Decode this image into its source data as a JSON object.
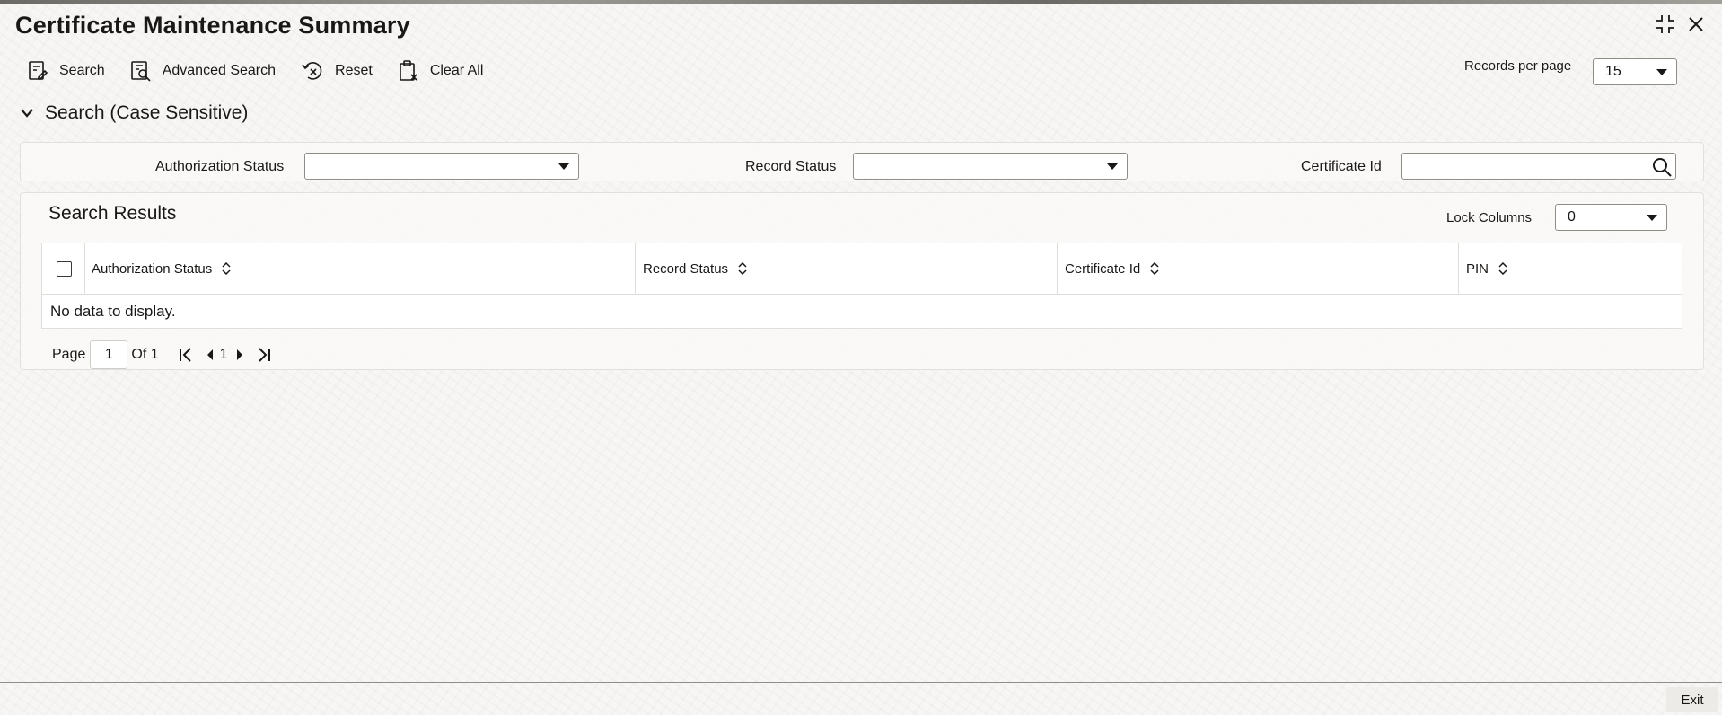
{
  "window": {
    "title": "Certificate Maintenance Summary",
    "icons": {
      "restore": "collapse-window-icon",
      "close": "close-icon"
    }
  },
  "toolbar": {
    "search": {
      "label": "Search",
      "icon": "search-form-icon"
    },
    "advanced_search": {
      "label": "Advanced Search",
      "icon": "advanced-search-icon"
    },
    "reset": {
      "label": "Reset",
      "icon": "reset-icon"
    },
    "clear_all": {
      "label": "Clear All",
      "icon": "clear-all-icon"
    }
  },
  "records_per_page": {
    "label": "Records per page",
    "value": "15"
  },
  "search_section": {
    "title": "Search (Case Sensitive)",
    "fields": {
      "authorization_status": {
        "label": "Authorization Status",
        "value": ""
      },
      "record_status": {
        "label": "Record Status",
        "value": ""
      },
      "certificate_id": {
        "label": "Certificate Id",
        "value": ""
      }
    }
  },
  "results": {
    "title": "Search Results",
    "lock_columns": {
      "label": "Lock Columns",
      "value": "0"
    },
    "columns": [
      "Authorization Status",
      "Record Status",
      "Certificate Id",
      "PIN"
    ],
    "empty_message": "No data to display.",
    "pagination": {
      "page_label": "Page",
      "current_page": "1",
      "of_label": "Of 1",
      "page_number": "1"
    }
  },
  "footer": {
    "exit_label": "Exit"
  }
}
